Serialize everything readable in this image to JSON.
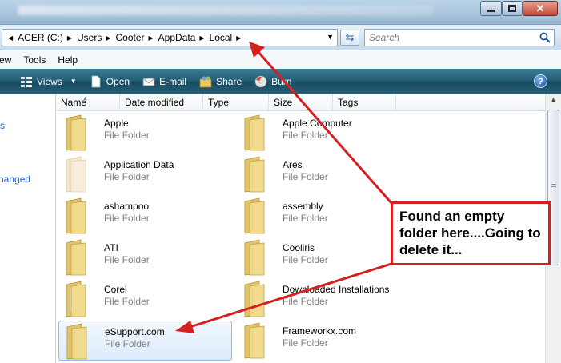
{
  "window": {
    "controls": {
      "minimize_icon": "minimize-icon",
      "maximize_icon": "maximize-icon",
      "close_icon": "close-icon"
    }
  },
  "address": {
    "crumbs": [
      "ACER (C:)",
      "Users",
      "Cooter",
      "AppData",
      "Local"
    ],
    "search_placeholder": "Search"
  },
  "menu": [
    "ew",
    "Tools",
    "Help"
  ],
  "commands": {
    "views": "Views",
    "open": "Open",
    "email": "E-mail",
    "share": "Share",
    "burn": "Burn",
    "help": "?"
  },
  "nav": {
    "item_partial_1": "s",
    "item_partial_2": "hanged"
  },
  "columns": [
    "Name",
    "Date modified",
    "Type",
    "Size",
    "Tags"
  ],
  "items": [
    {
      "name": "Apple",
      "type": "File Folder"
    },
    {
      "name": "Apple Computer",
      "type": "File Folder"
    },
    {
      "name": "Application Data",
      "type": "File Folder"
    },
    {
      "name": "Ares",
      "type": "File Folder"
    },
    {
      "name": "ashampoo",
      "type": "File Folder"
    },
    {
      "name": "assembly",
      "type": "File Folder"
    },
    {
      "name": "ATI",
      "type": "File Folder"
    },
    {
      "name": "Cooliris",
      "type": "File Folder"
    },
    {
      "name": "Corel",
      "type": "File Folder"
    },
    {
      "name": "Downloaded Installations",
      "type": "File Folder"
    },
    {
      "name": "eSupport.com",
      "type": "File Folder"
    },
    {
      "name": "Frameworkx.com",
      "type": "File Folder"
    }
  ],
  "annotation": {
    "text": "Found an empty folder here....Going to delete it...",
    "color": "#d62020"
  }
}
